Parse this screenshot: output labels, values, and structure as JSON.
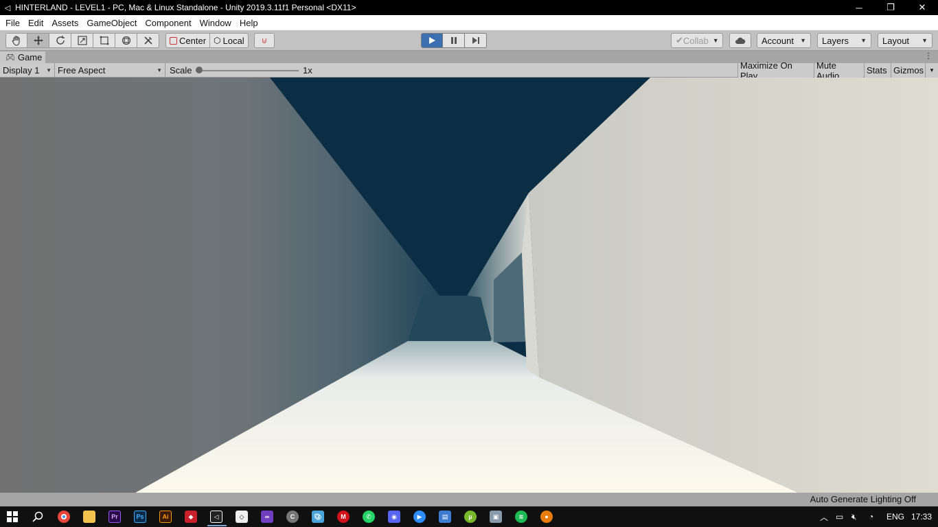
{
  "window": {
    "title": "HINTERLAND - LEVEL1 - PC, Mac & Linux Standalone - Unity 2019.3.11f1 Personal <DX11>",
    "controls": {
      "minimize": "─",
      "restore": "❐",
      "close": "✕"
    }
  },
  "menu": [
    "File",
    "Edit",
    "Assets",
    "GameObject",
    "Component",
    "Window",
    "Help"
  ],
  "toolbar": {
    "tools": [
      "hand-tool",
      "move-tool",
      "rotate-tool",
      "scale-tool",
      "rect-tool",
      "transform-tool",
      "custom-editor-tool"
    ],
    "active_tool": "move-tool",
    "pivot_mode": "Center",
    "pivot_rotation": "Local",
    "playback": {
      "playing": true
    },
    "collab": "Collab",
    "account": "Account",
    "layers": "Layers",
    "layout": "Layout"
  },
  "game_tab": {
    "label": "Game"
  },
  "game_bar": {
    "display": "Display 1",
    "aspect": "Free Aspect",
    "scale_label": "Scale",
    "scale_value": "1x",
    "scale_level": 0.0,
    "maximize_on_play": "Maximize On Play",
    "mute_audio": "Mute Audio",
    "stats": "Stats",
    "gizmos": "Gizmos"
  },
  "status": {
    "message": "Auto Generate Lighting Off"
  },
  "taskbar": {
    "apps": [
      "windows-start",
      "search",
      "chrome",
      "file-explorer",
      "premiere-pro",
      "photoshop",
      "illustrator",
      "sketchup",
      "unity",
      "unity-hub",
      "visual-studio",
      "ccleaner",
      "paint-app",
      "mcafee",
      "whatsapp",
      "discord",
      "zoom",
      "app-window",
      "utorrent",
      "monitor-app",
      "spotify",
      "blender"
    ],
    "colors": {
      "chrome": "#e8453c",
      "explorer": "#f2c14e",
      "premiere": "#2a0a4a",
      "photoshop": "#0a2a4a",
      "illustrator": "#3a1a00",
      "vs": "#6f3fbf",
      "whatsapp": "#25d366",
      "discord": "#5865f2",
      "zoom": "#2d8cff",
      "spotify": "#1db954",
      "blender": "#e87d0d"
    },
    "language": "ENG",
    "time": "17:33"
  }
}
